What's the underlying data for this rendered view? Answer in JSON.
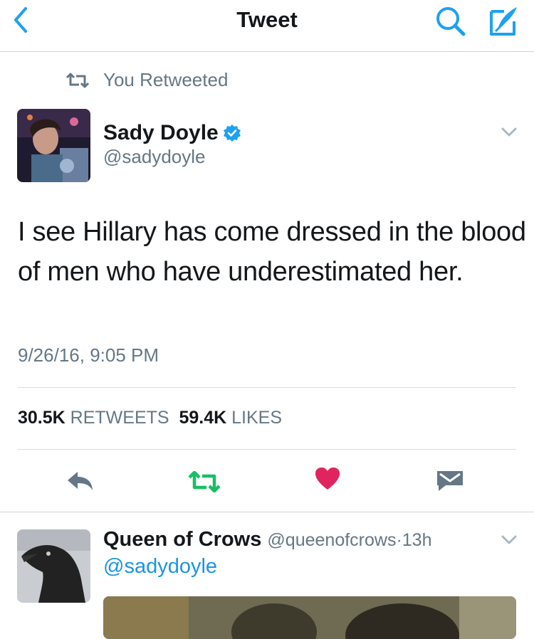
{
  "nav": {
    "title": "Tweet",
    "back_icon": "back-chevron-icon",
    "search_icon": "search-icon",
    "compose_icon": "compose-icon",
    "accent_color": "#1da1f2"
  },
  "retweet_banner": {
    "text": "You Retweeted",
    "icon": "retweet-icon"
  },
  "tweet": {
    "author_name": "Sady Doyle",
    "author_handle": "@sadydoyle",
    "verified": true,
    "text": "I see Hillary has come dressed in the blood of men who have underestimated her.",
    "timestamp": "9/26/16, 9:05 PM",
    "retweet_count": "30.5K",
    "retweet_label": "RETWEETS",
    "like_count": "59.4K",
    "like_label": "LIKES",
    "retweeted": true,
    "liked": true,
    "retweet_color": "#17bf63",
    "like_color": "#e0245e"
  },
  "reply": {
    "author_name": "Queen of Crows",
    "author_handle": "@queenofcrows",
    "separator": "·",
    "time": "13h",
    "mention": "@sadydoyle"
  }
}
